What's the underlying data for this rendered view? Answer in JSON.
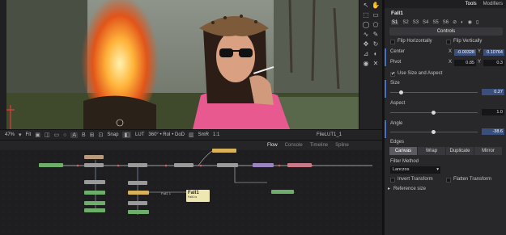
{
  "viewer": {
    "zoom": "47%",
    "fit": "Fit",
    "lut": "LUT",
    "roi": "360° • RoI • DoD",
    "smr": "SmR",
    "ratio": "1:1",
    "snap": "Snap",
    "clip_name": "FileLUT1_1",
    "toolbar_icons": [
      "image-icon",
      "channel-icon",
      "a-icon",
      "b-icon",
      "grid-icon"
    ]
  },
  "node_editor": {
    "tabs": [
      "Flow",
      "Console",
      "Timeline",
      "Spline"
    ],
    "active_tab": "Flow",
    "note_title": "Fall1",
    "note_sub": "Fall1 is",
    "active_label": "Fall1 1"
  },
  "panel": {
    "tabs": [
      "Tools",
      "Modifiers"
    ],
    "active_tab": "Tools",
    "tool_name": "Fall1",
    "versions": [
      "S1",
      "S2",
      "S3",
      "S4",
      "S5",
      "S6"
    ],
    "active_version": "S1",
    "controls_label": "Controls",
    "flip_h": "Flip Horizontally",
    "flip_v": "Flip Vertically",
    "center_label": "Center",
    "center_x_label": "X",
    "center_x": "-0.00328",
    "center_y_label": "Y",
    "center_y": "0.10764",
    "pivot_label": "Pivot",
    "pivot_x_label": "X",
    "pivot_x": "0.85",
    "pivot_y_label": "Y",
    "pivot_y": "0.3",
    "use_size_aspect": "Use Size and Aspect",
    "size_label": "Size",
    "size_value": "0.27",
    "aspect_label": "Aspect",
    "aspect_value": "1.0",
    "angle_label": "Angle",
    "angle_value": "-38.6",
    "edges_label": "Edges",
    "edges_options": [
      "Canvas",
      "Wrap",
      "Duplicate",
      "Mirror"
    ],
    "edges_active": "Canvas",
    "filter_label": "Filter Method",
    "filter_value": "Lanczos",
    "invert_transform": "Invert Transform",
    "flatten_transform": "Flatten Transform",
    "reference_size": "Reference size"
  },
  "colors": {
    "accent_blue": "#4b6ec7",
    "value_highlight": "#3b4f7d",
    "note_yellow": "#efe7b2"
  }
}
